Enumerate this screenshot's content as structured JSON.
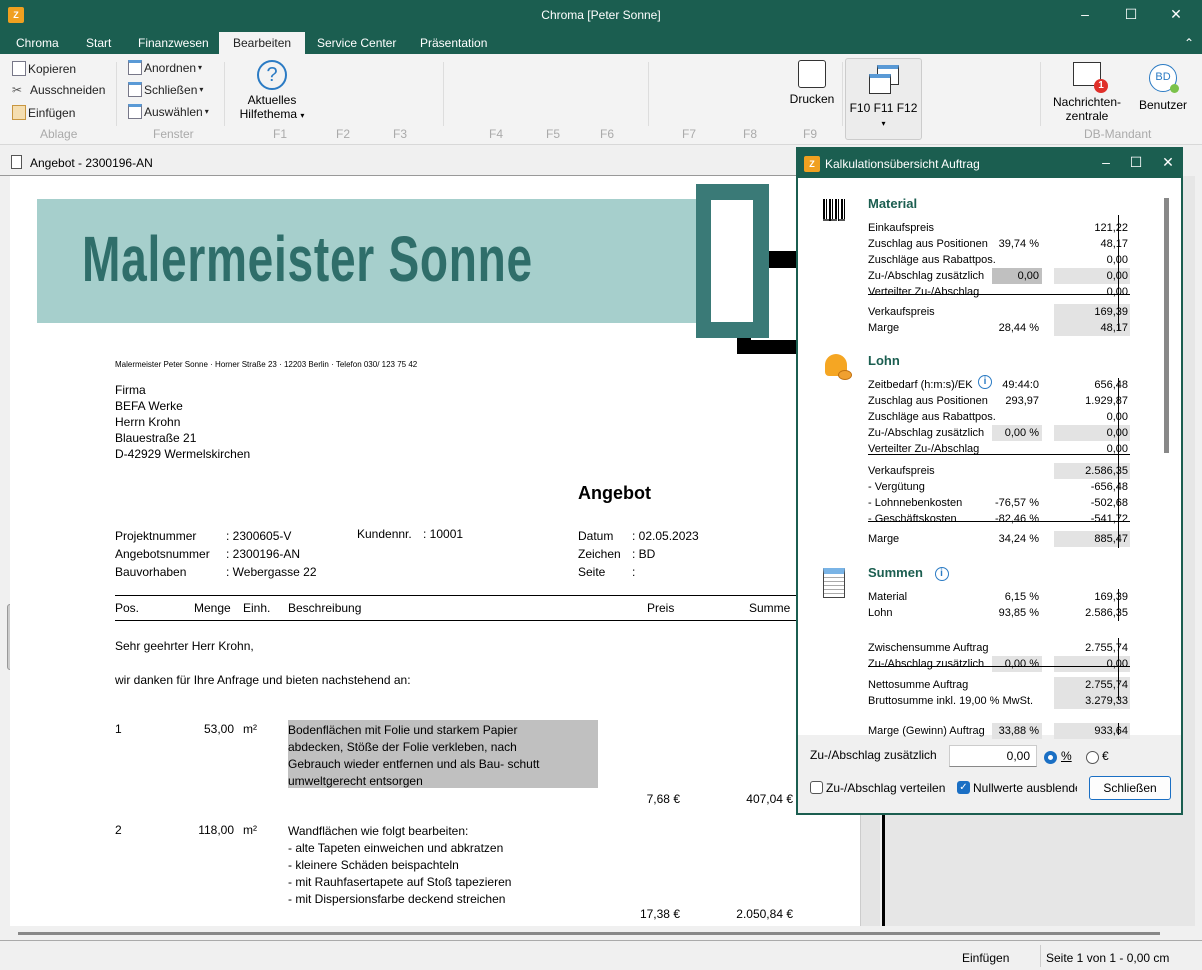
{
  "window": {
    "title": "Chroma [Peter Sonne]"
  },
  "tabs": [
    "Chroma",
    "Start",
    "Finanzwesen",
    "Bearbeiten",
    "Service Center",
    "Präsentation"
  ],
  "ribbon": {
    "ablage": {
      "kopieren": "Kopieren",
      "ausschneiden": "Ausschneiden",
      "einfuegen": "Einfügen",
      "label": "Ablage"
    },
    "fenster": {
      "anordnen": "Anordnen",
      "schliessen": "Schließen",
      "auswaehlen": "Auswählen",
      "label": "Fenster"
    },
    "hilfe": {
      "line1": "Aktuelles",
      "line2": "Hilfethema"
    },
    "fkeys": [
      "F1",
      "F2",
      "F3",
      "F4",
      "F5",
      "F6",
      "F7",
      "F8",
      "F9"
    ],
    "drucken": "Drucken",
    "f10": "F10 F11 F12",
    "nachrichten": {
      "line1": "Nachrichten-",
      "line2": "zentrale",
      "badge": "1"
    },
    "benutzer": {
      "label": "Benutzer",
      "initials": "BD"
    },
    "mandant": "DB-Mandant"
  },
  "document": {
    "title": "Angebot - 2300196-AN",
    "logo": "Malermeister Sonne",
    "sender": "Malermeister Peter Sonne · Horner Straße 23 · 12203 Berlin · Telefon 030/ 123 75 42",
    "address": [
      "Firma",
      "BEFA Werke",
      "Herrn Krohn",
      "Blauestraße 21",
      "D-42929 Wermelskirchen"
    ],
    "heading": "Angebot",
    "meta": {
      "projekt_l": "Projektnummer",
      "projekt": ": 2300605-V",
      "angebot_l": "Angebotsnummer",
      "angebot": ": 2300196-AN",
      "bau_l": "Bauvorhaben",
      "bau": ": Webergasse 22",
      "kunde_l": "Kundennr.",
      "kunde": ": 10001",
      "datum_l": "Datum",
      "datum": ": 02.05.2023",
      "zeichen_l": "Zeichen",
      "zeichen": ": BD",
      "seite_l": "Seite",
      "seite": ":"
    },
    "columns": [
      "Pos.",
      "Menge",
      "Einh.",
      "Beschreibung",
      "Preis",
      "Summe"
    ],
    "greeting": "Sehr geehrter Herr Krohn,",
    "intro": "wir danken für Ihre Anfrage und bieten nachstehend an:",
    "items": [
      {
        "pos": "1",
        "menge": "53,00",
        "einh": "m²",
        "lines": [
          "Bodenflächen mit Folie und starkem Papier",
          "abdecken, Stöße der Folie verkleben, nach",
          "Gebrauch wieder entfernen und als Bau- schutt",
          "umweltgerecht entsorgen"
        ],
        "preis": "7,68 €",
        "summe": "407,04 €"
      },
      {
        "pos": "2",
        "menge": "118,00",
        "einh": "m²",
        "lines": [
          "Wandflächen wie folgt bearbeiten:",
          "- alte Tapeten einweichen und abkratzen",
          "- kleinere Schäden beispachteln",
          "- mit Rauhfasertapete auf Stoß tapezieren",
          "- mit Dispersionsfarbe deckend streichen"
        ],
        "preis": "17,38 €",
        "summe": "2.050,84 €"
      }
    ]
  },
  "dialog": {
    "title": "Kalkulationsübersicht Auftrag",
    "material": {
      "title": "Material",
      "rows": [
        {
          "l": "Einkaufspreis",
          "p": "",
          "v": "121,22"
        },
        {
          "l": "Zuschlag aus Positionen",
          "p": "39,74 %",
          "v": "48,17"
        },
        {
          "l": "Zuschläge aus Rabattpos.",
          "p": "",
          "v": "0,00"
        },
        {
          "l": "Zu-/Abschlag zusätzlich",
          "p": "0,00",
          "v": "0,00"
        },
        {
          "l": "Verteilter Zu-/Abschlag",
          "p": "",
          "v": "0,00"
        },
        {
          "l": "Verkaufspreis",
          "p": "",
          "v": "169,39"
        },
        {
          "l": "Marge",
          "p": "28,44 %",
          "v": "48,17"
        }
      ]
    },
    "lohn": {
      "title": "Lohn",
      "rows": [
        {
          "l": "Zeitbedarf (h:m:s)/EK",
          "p": "49:44:0",
          "v": "656,48"
        },
        {
          "l": "Zuschlag aus Positionen",
          "p": "293,97",
          "v": "1.929,87"
        },
        {
          "l": "Zuschläge aus Rabattpos.",
          "p": "",
          "v": "0,00"
        },
        {
          "l": "Zu-/Abschlag zusätzlich",
          "p": "0,00 %",
          "v": "0,00"
        },
        {
          "l": "Verteilter Zu-/Abschlag",
          "p": "",
          "v": "0,00"
        },
        {
          "l": "Verkaufspreis",
          "p": "",
          "v": "2.586,35"
        },
        {
          "l": " - Vergütung",
          "p": "",
          "v": "-656,48"
        },
        {
          "l": " - Lohnnebenkosten",
          "p": "-76,57 %",
          "v": "-502,68"
        },
        {
          "l": " - Geschäftskosten",
          "p": "-82,46 %",
          "v": "-541,72"
        },
        {
          "l": "Marge",
          "p": "34,24 %",
          "v": "885,47"
        }
      ]
    },
    "summen": {
      "title": "Summen",
      "rows": [
        {
          "l": "Material",
          "p": "6,15 %",
          "v": "169,39"
        },
        {
          "l": "Lohn",
          "p": "93,85 %",
          "v": "2.586,35"
        },
        {
          "l": "Zwischensumme Auftrag",
          "p": "",
          "v": "2.755,74"
        },
        {
          "l": "Zu-/Abschlag zusätzlich",
          "p": "0,00 %",
          "v": "0,00"
        },
        {
          "l": "Nettosumme Auftrag",
          "p": "",
          "v": "2.755,74"
        },
        {
          "l": "Bruttosumme inkl. 19,00 % MwSt.",
          "p": "",
          "v": "3.279,33"
        },
        {
          "l": "Marge (Gewinn) Auftrag",
          "p": "33,88 %",
          "v": "933,64"
        }
      ]
    },
    "zuschlag_label": "Zu-/Abschlag zusätzlich",
    "zuschlag_value": "0,00",
    "radio_pct": "%",
    "radio_eur": "€",
    "radio_selected": "%",
    "verteilen": "Zu-/Abschlag verteilen",
    "verteilen_checked": false,
    "nullwerte": "Nullwerte ausblende",
    "nullwerte_checked": true,
    "close": "Schließen"
  },
  "status": {
    "mode": "Einfügen",
    "page": "Seite 1 von 1 - 0,00 cm"
  }
}
